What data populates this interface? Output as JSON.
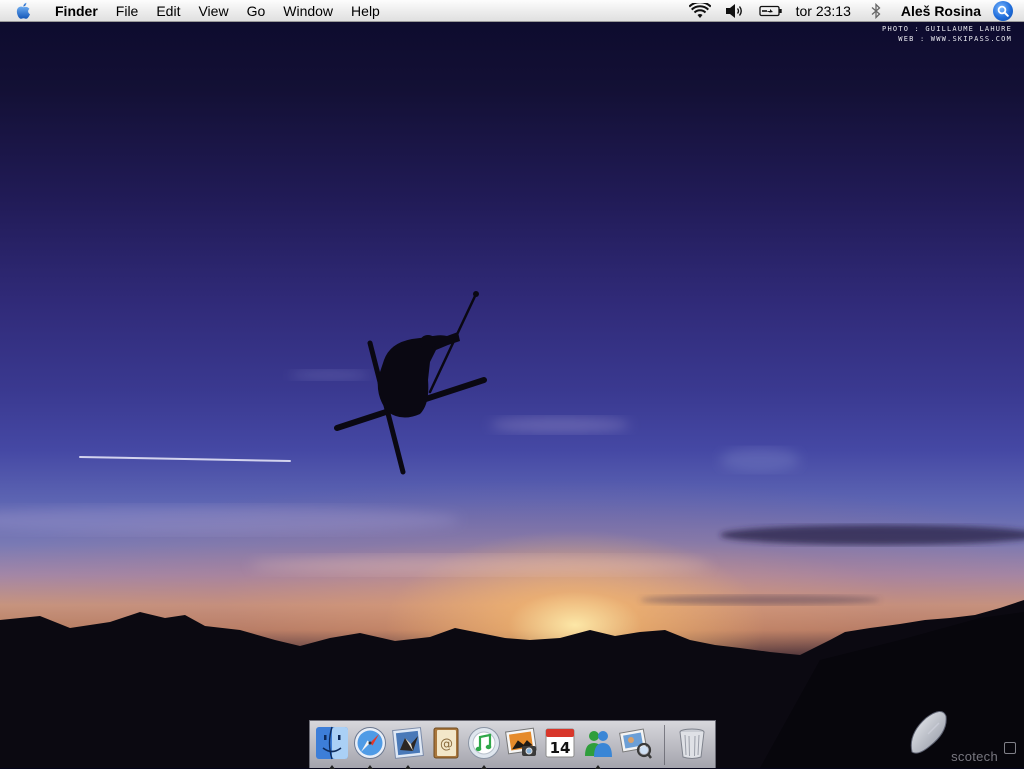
{
  "menubar": {
    "apple_icon": "apple-icon",
    "items": [
      {
        "label": "Finder",
        "bold": true
      },
      {
        "label": "File"
      },
      {
        "label": "Edit"
      },
      {
        "label": "View"
      },
      {
        "label": "Go"
      },
      {
        "label": "Window"
      },
      {
        "label": "Help"
      }
    ],
    "status_icons": [
      "wifi-icon",
      "volume-icon",
      "battery-icon"
    ],
    "clock": "tor 23:13",
    "bluetooth_icon": "bluetooth-icon",
    "user": "Aleš Rosina",
    "spotlight_icon": "spotlight-icon"
  },
  "wallpaper": {
    "credit_line1": "PHOTO : GUILLAUME LAHURE",
    "credit_line2": "WEB : WWW.SKIPASS.COM",
    "watermark": "scotech"
  },
  "dock": {
    "apps": [
      {
        "name": "finder-icon",
        "running": true
      },
      {
        "name": "safari-icon",
        "running": true
      },
      {
        "name": "mail-icon",
        "running": true
      },
      {
        "name": "address-book-icon",
        "running": false
      },
      {
        "name": "itunes-icon",
        "running": true
      },
      {
        "name": "iphoto-icon",
        "running": false
      },
      {
        "name": "ical-icon",
        "running": false,
        "date": "14"
      },
      {
        "name": "messenger-icon",
        "running": true
      },
      {
        "name": "preview-icon",
        "running": false
      }
    ],
    "trash_icon": "trash-icon"
  },
  "colors": {
    "menubar": "#eeeeee",
    "spotlight": "#1f6ddb",
    "sky_top": "#0c0a2c",
    "sky_mid": "#3a3990",
    "sunset": "#ffeca8"
  }
}
